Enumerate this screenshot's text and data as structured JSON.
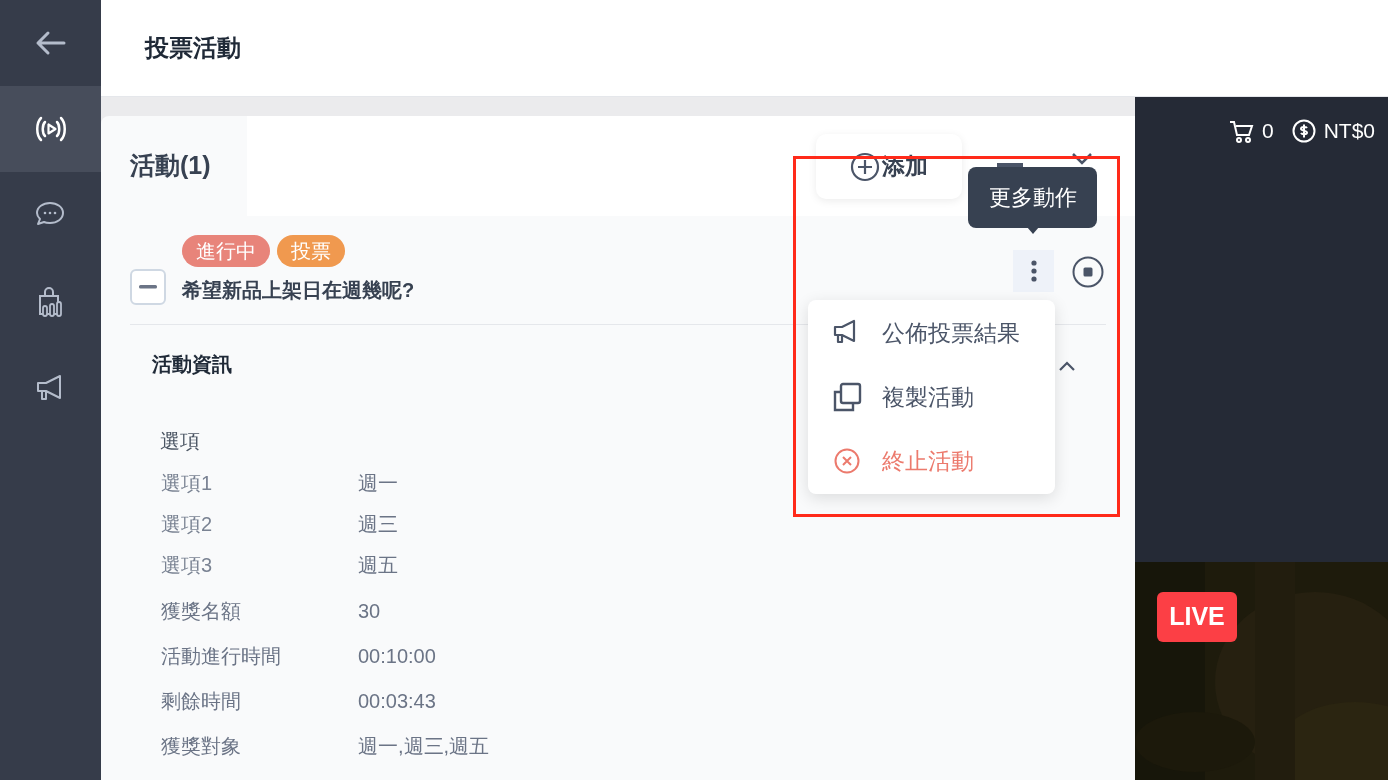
{
  "sidebar": {
    "items": [
      {
        "kind": "back",
        "selected": false
      },
      {
        "kind": "live",
        "selected": true
      },
      {
        "kind": "chat",
        "selected": false
      },
      {
        "kind": "shop",
        "selected": false
      },
      {
        "kind": "megaphone",
        "selected": false
      }
    ]
  },
  "header": {
    "title": "投票活動"
  },
  "panel": {
    "title": "活動(1)",
    "add_button": "添加"
  },
  "activity": {
    "tags": [
      {
        "label": "進行中",
        "color": "#e8847a"
      },
      {
        "label": "投票",
        "color": "#f0994f"
      }
    ],
    "question": "希望新品上架日在週幾呢?",
    "expanded": true
  },
  "tooltip": "更多動作",
  "menu": [
    {
      "label": "公佈投票結果",
      "kind": "announce"
    },
    {
      "label": "複製活動",
      "kind": "copy"
    },
    {
      "label": "終止活動",
      "kind": "stop"
    }
  ],
  "info": {
    "title": "活動資訊",
    "section": "選項",
    "options": [
      {
        "label": "選項1",
        "value": "週一"
      },
      {
        "label": "選項2",
        "value": "週三"
      },
      {
        "label": "選項3",
        "value": "週五"
      }
    ],
    "fields": [
      {
        "label": "獲獎名額",
        "value": "30"
      },
      {
        "label": "活動進行時間",
        "value": "00:10:00"
      },
      {
        "label": "剩餘時間",
        "value": "00:03:43"
      },
      {
        "label": "獲獎對象",
        "value": "週一,週三,週五"
      }
    ]
  },
  "stream": {
    "cart_count": "0",
    "balance": "NT$0",
    "badge": "LIVE"
  }
}
